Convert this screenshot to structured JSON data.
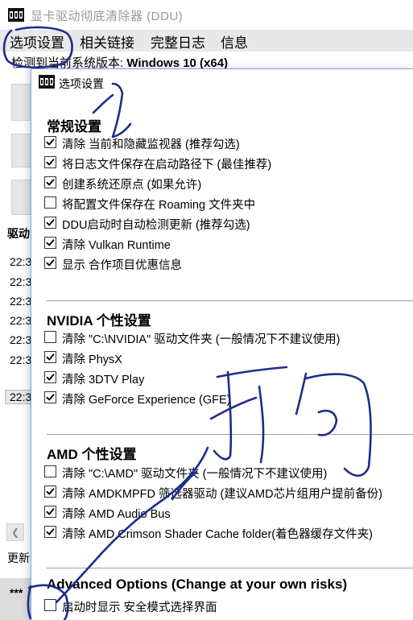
{
  "main_window": {
    "title": "显卡驱动彻底清除器 (DDU)",
    "menu": [
      "选项设置",
      "相关链接",
      "完整日志",
      "信息"
    ],
    "os_info_prefix": "检测到当前系统版本: ",
    "os_info_value": "Windows 10 (x64)",
    "log_label": "驱动",
    "log_times": [
      "22:3",
      "22:3",
      "22:3",
      "22:3",
      "22:3",
      "22:3",
      "22:3"
    ],
    "status_label": "更新",
    "masked_text": "***"
  },
  "dialog": {
    "title": "选项设置",
    "sections": [
      {
        "title": "常规设置",
        "options": [
          {
            "label": "清除 当前和隐藏监视器 (推荐勾选)",
            "checked": true
          },
          {
            "label": "将日志文件保存在启动路径下 (最佳推荐)",
            "checked": true
          },
          {
            "label": "创建系统还原点 (如果允许)",
            "checked": true
          },
          {
            "label": "将配置文件保存在 Roaming 文件夹中",
            "checked": false
          },
          {
            "label": "DDU启动时自动检测更新 (推荐勾选)",
            "checked": true
          },
          {
            "label": "清除 Vulkan Runtime",
            "checked": true
          },
          {
            "label": "显示 合作项目优惠信息",
            "checked": true
          }
        ]
      },
      {
        "title": "NVIDIA 个性设置",
        "options": [
          {
            "label": "清除 \"C:\\NVIDIA\" 驱动文件夹 (一般情况下不建议使用)",
            "checked": false
          },
          {
            "label": "清除 PhysX",
            "checked": true
          },
          {
            "label": "清除 3DTV Play",
            "checked": true
          },
          {
            "label": "清除 GeForce Experience (GFE)",
            "checked": true
          }
        ]
      },
      {
        "title": "AMD 个性设置",
        "options": [
          {
            "label": "清除 \"C:\\AMD\" 驱动文件夹 (一般情况下不建议使用)",
            "checked": false
          },
          {
            "label": "清除 AMDKMPFD 筛选器驱动 (建议AMD芯片组用户提前备份)",
            "checked": true
          },
          {
            "label": "清除 AMD Audio Bus",
            "checked": true
          },
          {
            "label": "清除 AMD Crimson Shader Cache folder(着色器缓存文件夹)",
            "checked": true
          }
        ]
      },
      {
        "title": "Advanced Options (Change at your own risks)",
        "options": [
          {
            "label": "启动时显示 安全模式选择界面",
            "checked": false
          }
        ]
      }
    ]
  },
  "colors": {
    "ink": "#1e2c8c",
    "checkmark": "#000000",
    "menubar": "#e8e8e8",
    "dialog_border": "#7aa7d8"
  },
  "icons": {
    "app": "ddu-logo-icon",
    "check": "checkmark-icon"
  }
}
